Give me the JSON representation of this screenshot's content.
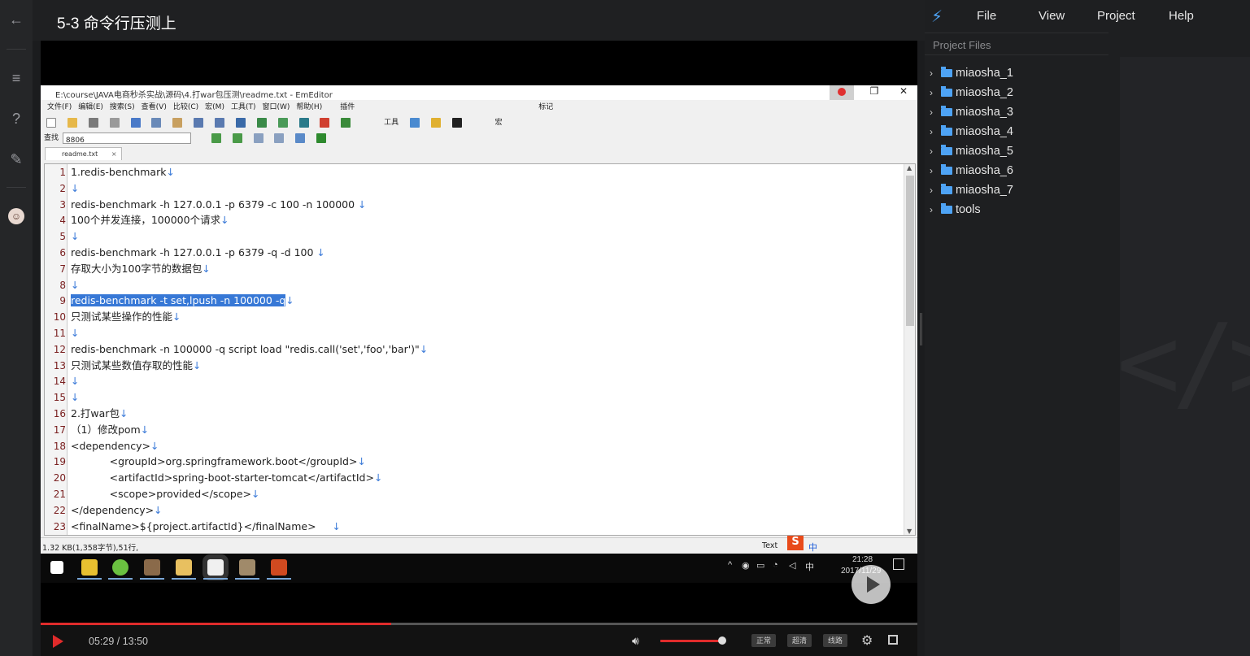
{
  "player": {
    "title": "5-3 命令行压测上",
    "time": "05:29 / 13:50",
    "progress": 0.4,
    "volume": 0.95,
    "quality_buttons": [
      "正常",
      "超清",
      "线路"
    ]
  },
  "emeditor": {
    "title": "E:\\course\\JAVA电商秒杀实战\\源码\\4.打war包压测\\readme.txt - EmEditor",
    "menu": [
      "文件(F)",
      "编辑(E)",
      "搜索(S)",
      "查看(V)",
      "比较(C)",
      "宏(M)",
      "工具(T)",
      "窗口(W)",
      "帮助(H)",
      "插件",
      "标记"
    ],
    "toolbar_labels": [
      "工具",
      "宏"
    ],
    "find_label": "查找",
    "find_value": "8806",
    "tab": "readme.txt",
    "lines": [
      {
        "n": "1",
        "t": "1.redis-benchmark",
        "arrow": "↓"
      },
      {
        "n": "2",
        "t": "",
        "arrow": "↓"
      },
      {
        "n": "3",
        "t": "redis-benchmark -h 127.0.0.1 -p 6379 -c 100 -n 100000 ",
        "arrow": "↓"
      },
      {
        "n": "4",
        "t": "100个并发连接，100000个请求",
        "arrow": "↓"
      },
      {
        "n": "5",
        "t": "",
        "arrow": "↓"
      },
      {
        "n": "6",
        "t": "redis-benchmark -h 127.0.0.1 -p 6379 -q -d 100 ",
        "arrow": "↓"
      },
      {
        "n": "7",
        "t": "存取大小为100字节的数据包",
        "arrow": "↓"
      },
      {
        "n": "8",
        "t": "",
        "arrow": "↓"
      },
      {
        "n": "9",
        "t": "redis-benchmark -t set,lpush -n 100000 -q",
        "arrow": "↓",
        "selected": true
      },
      {
        "n": "10",
        "t": "只测试某些操作的性能",
        "arrow": "↓"
      },
      {
        "n": "11",
        "t": "",
        "arrow": "↓"
      },
      {
        "n": "12",
        "t": "redis-benchmark -n 100000 -q script load \"redis.call('set','foo','bar')\"",
        "arrow": "↓"
      },
      {
        "n": "13",
        "t": "只测试某些数值存取的性能",
        "arrow": "↓"
      },
      {
        "n": "14",
        "t": "",
        "arrow": "↓"
      },
      {
        "n": "15",
        "t": "",
        "arrow": "↓"
      },
      {
        "n": "16",
        "t": "2.打war包",
        "arrow": "↓"
      },
      {
        "n": "17",
        "t": "（1）修改pom",
        "arrow": "↓"
      },
      {
        "n": "18",
        "t": "<dependency>",
        "arrow": "↓"
      },
      {
        "n": "19",
        "t": "            <groupId>org.springframework.boot</groupId>",
        "arrow": "↓"
      },
      {
        "n": "20",
        "t": "            <artifactId>spring-boot-starter-tomcat</artifactId>",
        "arrow": "↓"
      },
      {
        "n": "21",
        "t": "            <scope>provided</scope>",
        "arrow": "↓"
      },
      {
        "n": "22",
        "t": "</dependency>",
        "arrow": "↓"
      },
      {
        "n": "23",
        "t": "<finalName>${project.artifactId}</finalName>     ",
        "arrow": "↓"
      }
    ],
    "status": "1.32 KB(1,358字节),51行,",
    "status_right": "Text"
  },
  "taskbar": {
    "clock_time": "21:28",
    "clock_date": "2017/11/29",
    "ime": "中"
  },
  "sidebar": {
    "menu": [
      "File",
      "View",
      "Project",
      "Help"
    ],
    "project_files_label": "Project Files",
    "folders": [
      "miaosha_1",
      "miaosha_2",
      "miaosha_3",
      "miaosha_4",
      "miaosha_5",
      "miaosha_6",
      "miaosha_7",
      "tools"
    ]
  }
}
